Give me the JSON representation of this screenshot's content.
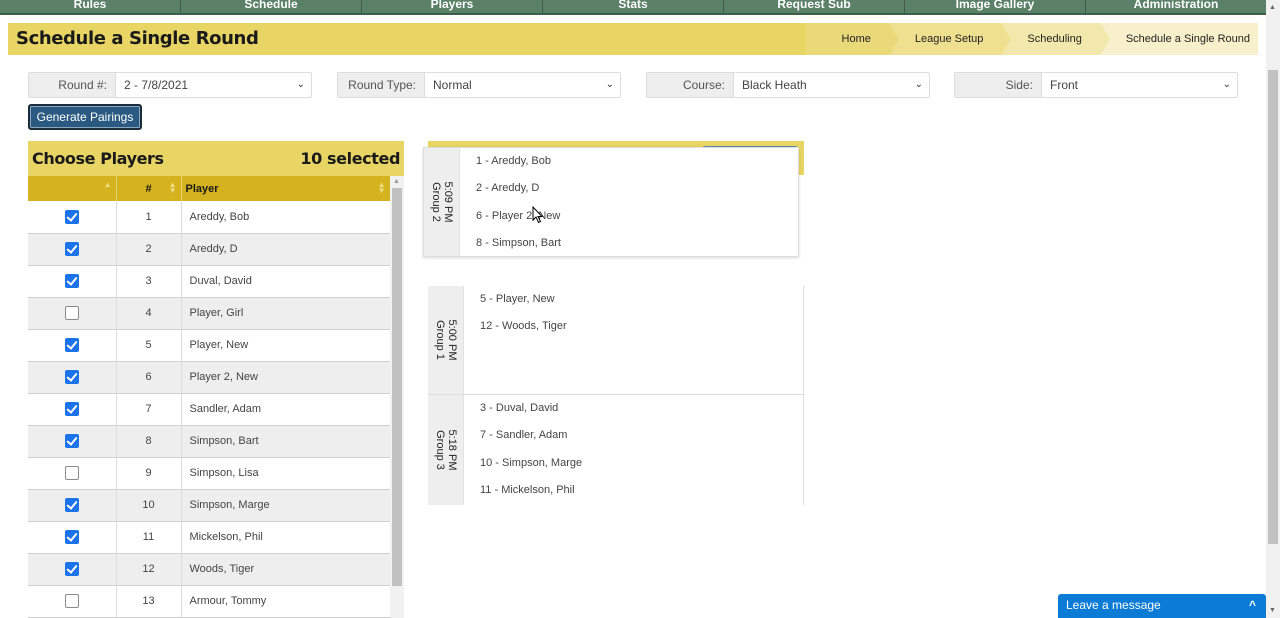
{
  "nav": {
    "items": [
      "Rules",
      "Schedule",
      "Players",
      "Stats",
      "Request Sub",
      "Image Gallery",
      "Administration"
    ]
  },
  "page": {
    "title": "Schedule a Single Round"
  },
  "breadcrumb": [
    "Home",
    "League Setup",
    "Scheduling",
    "Schedule a Single Round"
  ],
  "filters": {
    "round": {
      "label": "Round #:",
      "value": "2 - 7/8/2021"
    },
    "round_type": {
      "label": "Round Type:",
      "value": "Normal"
    },
    "course": {
      "label": "Course:",
      "value": "Black Heath"
    },
    "side": {
      "label": "Side:",
      "value": "Front"
    }
  },
  "actions": {
    "generate_label": "Generate Pairings"
  },
  "players_panel": {
    "title": "Choose Players",
    "selected_count": "10 selected",
    "columns": [
      "",
      "#",
      "Player"
    ],
    "rows": [
      {
        "checked": true,
        "num": "1",
        "name": "Areddy, Bob"
      },
      {
        "checked": true,
        "num": "2",
        "name": "Areddy, D"
      },
      {
        "checked": true,
        "num": "3",
        "name": "Duval, David"
      },
      {
        "checked": false,
        "num": "4",
        "name": "Player, Girl"
      },
      {
        "checked": true,
        "num": "5",
        "name": "Player, New"
      },
      {
        "checked": true,
        "num": "6",
        "name": "Player 2, New"
      },
      {
        "checked": true,
        "num": "7",
        "name": "Sandler, Adam"
      },
      {
        "checked": true,
        "num": "8",
        "name": "Simpson, Bart"
      },
      {
        "checked": false,
        "num": "9",
        "name": "Simpson, Lisa"
      },
      {
        "checked": true,
        "num": "10",
        "name": "Simpson, Marge"
      },
      {
        "checked": true,
        "num": "11",
        "name": "Mickelson, Phil"
      },
      {
        "checked": true,
        "num": "12",
        "name": "Woods, Tiger"
      },
      {
        "checked": false,
        "num": "13",
        "name": "Armour, Tommy"
      }
    ]
  },
  "groups": {
    "dragging": {
      "time": "5:09 PM",
      "name": "Group 2",
      "players": [
        "1 - Areddy, Bob",
        "2 - Areddy, D",
        "6 - Player 2, New",
        "8 - Simpson, Bart"
      ]
    },
    "group1": {
      "time": "5:00 PM",
      "name": "Group 1",
      "players": [
        "5 - Player, New",
        "12 - Woods, Tiger"
      ]
    },
    "group3": {
      "time": "5:18 PM",
      "name": "Group 3",
      "players": [
        "3 - Duval, David",
        "7 - Sandler, Adam",
        "10 - Simpson, Marge",
        "11 - Mickelson, Phil"
      ]
    }
  },
  "chat": {
    "label": "Leave a message"
  },
  "icons": {
    "select_chevron": "⌄",
    "sort_both": "▲▼",
    "chat_caret": "^"
  },
  "colors": {
    "nav_green": "#5a8067",
    "title_yellow": "#e8d563",
    "table_header_gold": "#d4b31e",
    "primary_button": "#2a5a82",
    "checkbox_blue": "#1a73e8",
    "chat_blue": "#0b7bd6"
  }
}
